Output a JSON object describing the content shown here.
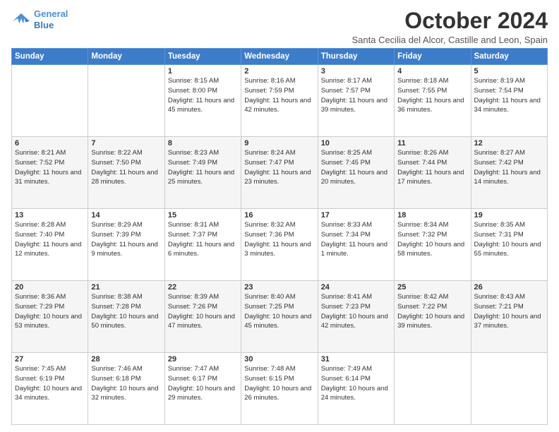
{
  "header": {
    "logo_line1": "General",
    "logo_line2": "Blue",
    "title": "October 2024",
    "subtitle": "Santa Cecilia del Alcor, Castille and Leon, Spain"
  },
  "weekdays": [
    "Sunday",
    "Monday",
    "Tuesday",
    "Wednesday",
    "Thursday",
    "Friday",
    "Saturday"
  ],
  "weeks": [
    [
      {
        "day": "",
        "info": ""
      },
      {
        "day": "",
        "info": ""
      },
      {
        "day": "1",
        "info": "Sunrise: 8:15 AM\nSunset: 8:00 PM\nDaylight: 11 hours and 45 minutes."
      },
      {
        "day": "2",
        "info": "Sunrise: 8:16 AM\nSunset: 7:59 PM\nDaylight: 11 hours and 42 minutes."
      },
      {
        "day": "3",
        "info": "Sunrise: 8:17 AM\nSunset: 7:57 PM\nDaylight: 11 hours and 39 minutes."
      },
      {
        "day": "4",
        "info": "Sunrise: 8:18 AM\nSunset: 7:55 PM\nDaylight: 11 hours and 36 minutes."
      },
      {
        "day": "5",
        "info": "Sunrise: 8:19 AM\nSunset: 7:54 PM\nDaylight: 11 hours and 34 minutes."
      }
    ],
    [
      {
        "day": "6",
        "info": "Sunrise: 8:21 AM\nSunset: 7:52 PM\nDaylight: 11 hours and 31 minutes."
      },
      {
        "day": "7",
        "info": "Sunrise: 8:22 AM\nSunset: 7:50 PM\nDaylight: 11 hours and 28 minutes."
      },
      {
        "day": "8",
        "info": "Sunrise: 8:23 AM\nSunset: 7:49 PM\nDaylight: 11 hours and 25 minutes."
      },
      {
        "day": "9",
        "info": "Sunrise: 8:24 AM\nSunset: 7:47 PM\nDaylight: 11 hours and 23 minutes."
      },
      {
        "day": "10",
        "info": "Sunrise: 8:25 AM\nSunset: 7:45 PM\nDaylight: 11 hours and 20 minutes."
      },
      {
        "day": "11",
        "info": "Sunrise: 8:26 AM\nSunset: 7:44 PM\nDaylight: 11 hours and 17 minutes."
      },
      {
        "day": "12",
        "info": "Sunrise: 8:27 AM\nSunset: 7:42 PM\nDaylight: 11 hours and 14 minutes."
      }
    ],
    [
      {
        "day": "13",
        "info": "Sunrise: 8:28 AM\nSunset: 7:40 PM\nDaylight: 11 hours and 12 minutes."
      },
      {
        "day": "14",
        "info": "Sunrise: 8:29 AM\nSunset: 7:39 PM\nDaylight: 11 hours and 9 minutes."
      },
      {
        "day": "15",
        "info": "Sunrise: 8:31 AM\nSunset: 7:37 PM\nDaylight: 11 hours and 6 minutes."
      },
      {
        "day": "16",
        "info": "Sunrise: 8:32 AM\nSunset: 7:36 PM\nDaylight: 11 hours and 3 minutes."
      },
      {
        "day": "17",
        "info": "Sunrise: 8:33 AM\nSunset: 7:34 PM\nDaylight: 11 hours and 1 minute."
      },
      {
        "day": "18",
        "info": "Sunrise: 8:34 AM\nSunset: 7:32 PM\nDaylight: 10 hours and 58 minutes."
      },
      {
        "day": "19",
        "info": "Sunrise: 8:35 AM\nSunset: 7:31 PM\nDaylight: 10 hours and 55 minutes."
      }
    ],
    [
      {
        "day": "20",
        "info": "Sunrise: 8:36 AM\nSunset: 7:29 PM\nDaylight: 10 hours and 53 minutes."
      },
      {
        "day": "21",
        "info": "Sunrise: 8:38 AM\nSunset: 7:28 PM\nDaylight: 10 hours and 50 minutes."
      },
      {
        "day": "22",
        "info": "Sunrise: 8:39 AM\nSunset: 7:26 PM\nDaylight: 10 hours and 47 minutes."
      },
      {
        "day": "23",
        "info": "Sunrise: 8:40 AM\nSunset: 7:25 PM\nDaylight: 10 hours and 45 minutes."
      },
      {
        "day": "24",
        "info": "Sunrise: 8:41 AM\nSunset: 7:23 PM\nDaylight: 10 hours and 42 minutes."
      },
      {
        "day": "25",
        "info": "Sunrise: 8:42 AM\nSunset: 7:22 PM\nDaylight: 10 hours and 39 minutes."
      },
      {
        "day": "26",
        "info": "Sunrise: 8:43 AM\nSunset: 7:21 PM\nDaylight: 10 hours and 37 minutes."
      }
    ],
    [
      {
        "day": "27",
        "info": "Sunrise: 7:45 AM\nSunset: 6:19 PM\nDaylight: 10 hours and 34 minutes."
      },
      {
        "day": "28",
        "info": "Sunrise: 7:46 AM\nSunset: 6:18 PM\nDaylight: 10 hours and 32 minutes."
      },
      {
        "day": "29",
        "info": "Sunrise: 7:47 AM\nSunset: 6:17 PM\nDaylight: 10 hours and 29 minutes."
      },
      {
        "day": "30",
        "info": "Sunrise: 7:48 AM\nSunset: 6:15 PM\nDaylight: 10 hours and 26 minutes."
      },
      {
        "day": "31",
        "info": "Sunrise: 7:49 AM\nSunset: 6:14 PM\nDaylight: 10 hours and 24 minutes."
      },
      {
        "day": "",
        "info": ""
      },
      {
        "day": "",
        "info": ""
      }
    ]
  ]
}
